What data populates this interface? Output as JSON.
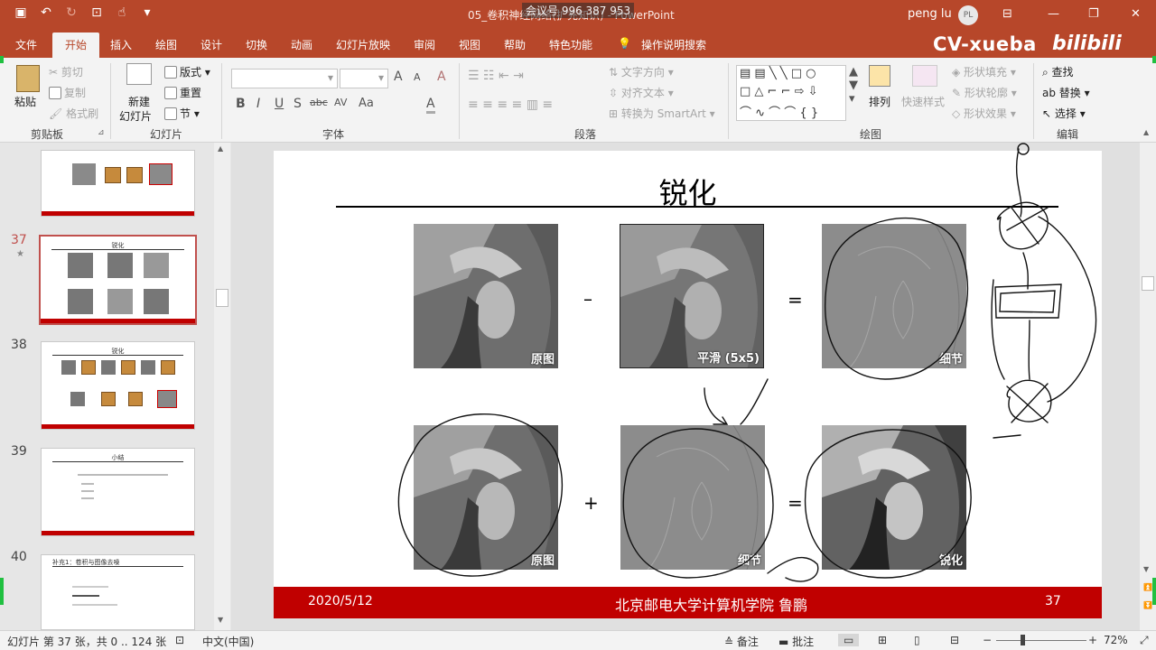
{
  "titlebar": {
    "doc_title": "05_卷积神经网络(扩充知识) - PowerPoint",
    "meeting": "会议号 996 387 953",
    "user": "peng lu",
    "avatar": "PL",
    "icons": [
      "save-icon",
      "undo-icon",
      "redo-icon",
      "present-icon",
      "touch-icon",
      "customize-icon"
    ]
  },
  "tabs": [
    "文件",
    "开始",
    "插入",
    "绘图",
    "设计",
    "切换",
    "动画",
    "幻灯片放映",
    "审阅",
    "视图",
    "帮助",
    "特色功能",
    "操作说明搜索"
  ],
  "brand": {
    "text": "CV-xueba",
    "logo": "bilibili"
  },
  "ribbon": {
    "clipboard": {
      "paste": "粘贴",
      "cut": "剪切",
      "copy": "复制",
      "format_painter": "格式刷",
      "label": "剪贴板"
    },
    "slides": {
      "new_slide_1": "新建",
      "new_slide_2": "幻灯片",
      "layout": "版式",
      "reset": "重置",
      "section": "节",
      "label": "幻灯片"
    },
    "font": {
      "label": "字体",
      "bold": "B",
      "italic": "I",
      "underline": "U",
      "strike": "S",
      "strike2": "abc",
      "spacing": "AV",
      "case": "Aa",
      "grow": "A",
      "shrink": "A",
      "clear": "A",
      "color": "A"
    },
    "paragraph": {
      "label": "段落",
      "text_direction": "文字方向",
      "align_text": "对齐文本",
      "smartart": "转换为 SmartArt"
    },
    "drawing": {
      "label": "绘图",
      "arrange": "排列",
      "quick_styles": "快速样式",
      "fill": "形状填充",
      "outline": "形状轮廓",
      "effects": "形状效果"
    },
    "editing": {
      "label": "编辑",
      "find": "查找",
      "replace": "替换",
      "select": "选择"
    }
  },
  "thumbnails": [
    {
      "num": "",
      "title": ""
    },
    {
      "num": "37",
      "title": "锐化"
    },
    {
      "num": "38",
      "title": "锐化"
    },
    {
      "num": "39",
      "title": "小结"
    },
    {
      "num": "40",
      "title": "补充1：卷积与图像去噪"
    }
  ],
  "slide": {
    "title": "锐化",
    "captions": {
      "orig": "原图",
      "smooth": "平滑 (5x5)",
      "detail": "细节",
      "sharp": "锐化"
    },
    "ops": {
      "minus": "–",
      "eq": "=",
      "plus": "+"
    },
    "footer": {
      "date": "2020/5/12",
      "org": "北京邮电大学计算机学院  鲁鹏",
      "page": "37"
    }
  },
  "status": {
    "slide_info": "幻灯片 第 37 张，共 0 .. 124 张",
    "language": "中文(中国)",
    "notes": "备注",
    "comments": "批注",
    "zoom": "72%"
  }
}
